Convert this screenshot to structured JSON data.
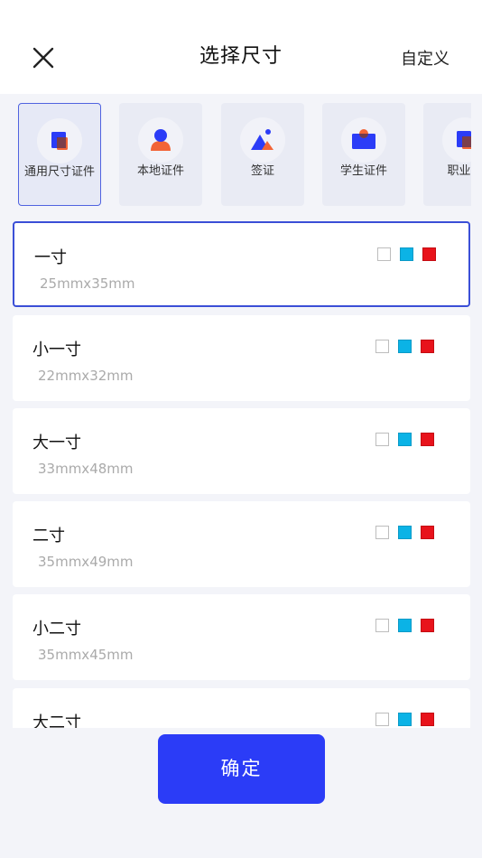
{
  "header": {
    "title": "选择尺寸",
    "custom_label": "自定义",
    "close_icon": "close-icon"
  },
  "categories": [
    {
      "label": "通用尺寸证件",
      "icon": "general-doc-icon",
      "selected": true
    },
    {
      "label": "本地证件",
      "icon": "person-icon",
      "selected": false
    },
    {
      "label": "签证",
      "icon": "landscape-icon",
      "selected": false
    },
    {
      "label": "学生证件",
      "icon": "student-card-icon",
      "selected": false
    },
    {
      "label": "职业资",
      "icon": "career-doc-icon",
      "selected": false
    }
  ],
  "sizes": [
    {
      "name": "一寸",
      "size": "25mmx35mm",
      "selected": true
    },
    {
      "name": "小一寸",
      "size": "22mmx32mm",
      "selected": false
    },
    {
      "name": "大一寸",
      "size": "33mmx48mm",
      "selected": false
    },
    {
      "name": "二寸",
      "size": "35mmx49mm",
      "selected": false
    },
    {
      "name": "小二寸",
      "size": "35mmx45mm",
      "selected": false
    },
    {
      "name": "大二寸",
      "size": "",
      "selected": false
    }
  ],
  "swatch_colors": {
    "white": "#ffffff",
    "blue": "#0bb3e6",
    "red": "#e8131b"
  },
  "accent_color": "#2b3cf7",
  "confirm_label": "确定"
}
